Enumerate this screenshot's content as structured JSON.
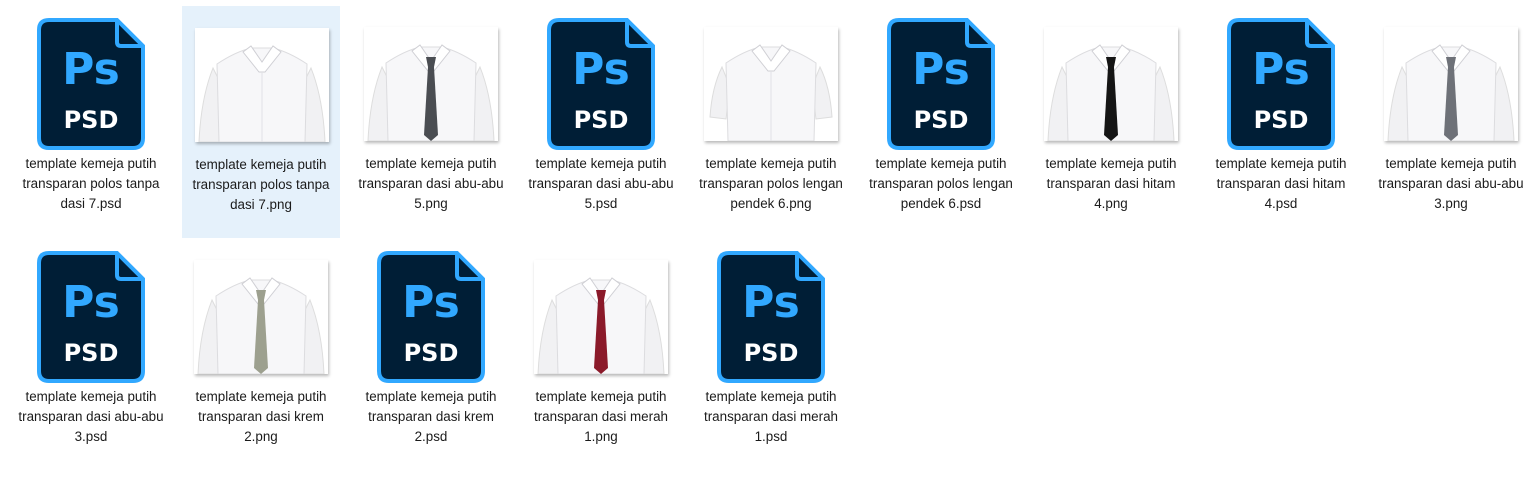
{
  "icons": {
    "psd": {
      "top_text": "Ps",
      "bottom_text": "PSD",
      "color_bg": "#001e36",
      "color_accent": "#31a8ff"
    }
  },
  "files": [
    {
      "name": "template kemeja putih transparan polos tanpa dasi 7.psd",
      "kind": "psd",
      "selected": false
    },
    {
      "name": "template kemeja putih transparan polos tanpa dasi 7.png",
      "kind": "png",
      "tie": "none",
      "selected": true
    },
    {
      "name": "template kemeja putih transparan dasi abu-abu 5.png",
      "kind": "png",
      "tie": "#4a4d52",
      "selected": false
    },
    {
      "name": "template kemeja putih transparan dasi abu-abu 5.psd",
      "kind": "psd",
      "selected": false
    },
    {
      "name": "template kemeja putih transparan polos lengan pendek 6.png",
      "kind": "png",
      "tie": "none",
      "selected": false
    },
    {
      "name": "template kemeja putih transparan polos lengan pendek 6.psd",
      "kind": "psd",
      "selected": false
    },
    {
      "name": "template kemeja putih transparan dasi hitam 4.png",
      "kind": "png",
      "tie": "#151515",
      "selected": false
    },
    {
      "name": "template kemeja putih transparan dasi hitam 4.psd",
      "kind": "psd",
      "selected": false
    },
    {
      "name": "template kemeja putih transparan dasi abu-abu 3.png",
      "kind": "png",
      "tie": "#6e7178",
      "selected": false
    },
    {
      "name": "template kemeja putih transparan dasi abu-abu 3.psd",
      "kind": "psd",
      "selected": false
    },
    {
      "name": "template kemeja putih transparan dasi krem 2.png",
      "kind": "png",
      "tie": "#9da08f",
      "selected": false
    },
    {
      "name": "template kemeja putih transparan dasi krem 2.psd",
      "kind": "psd",
      "selected": false
    },
    {
      "name": "template kemeja putih transparan dasi merah 1.png",
      "kind": "png",
      "tie": "#8b1a2a",
      "selected": false
    },
    {
      "name": "template kemeja putih transparan dasi merah 1.psd",
      "kind": "psd",
      "selected": false
    }
  ]
}
